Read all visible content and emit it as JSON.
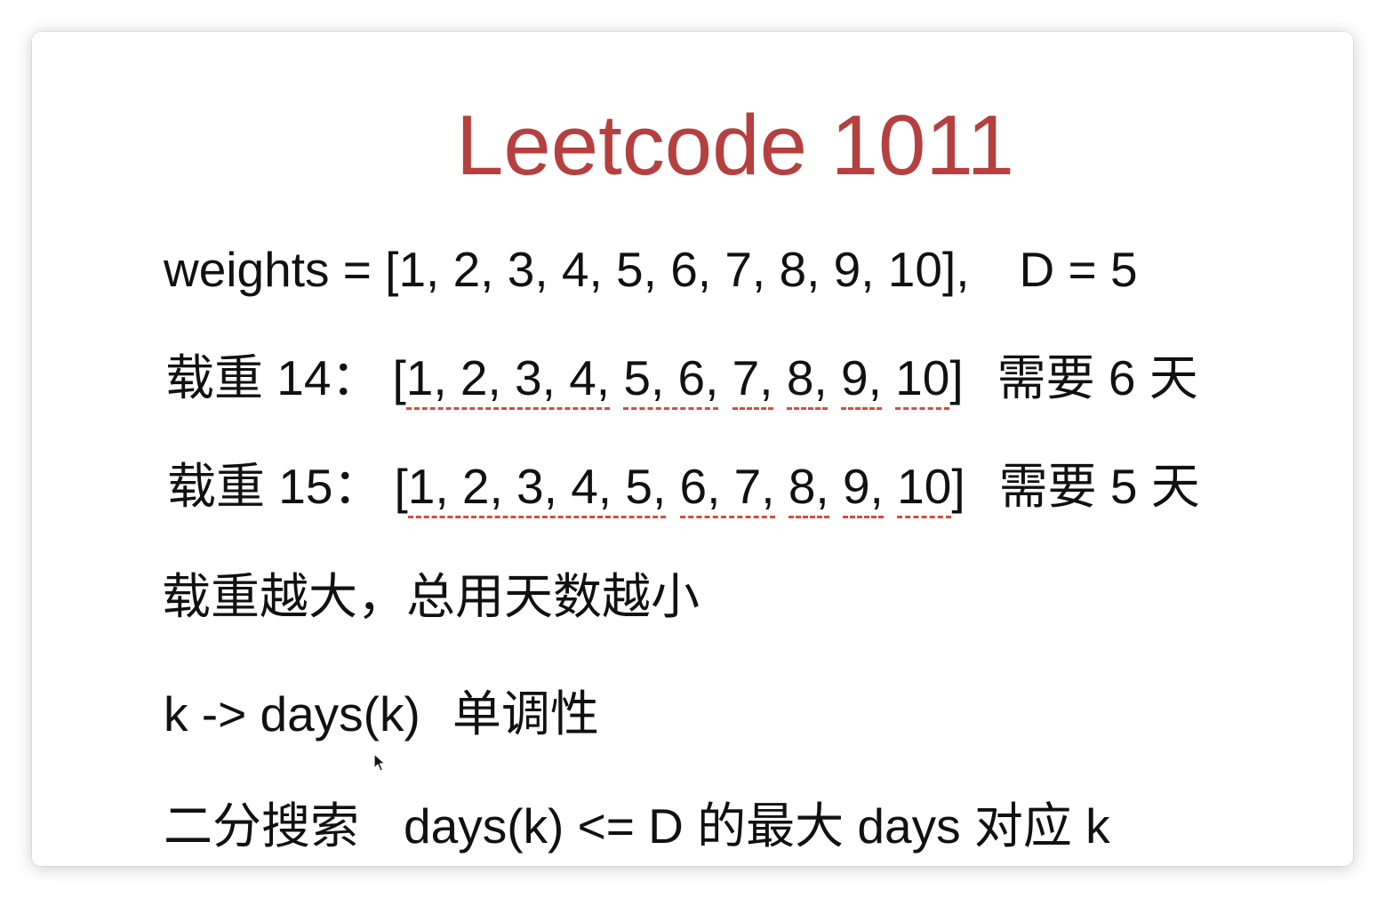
{
  "title": "Leetcode 1011",
  "line1": {
    "weights": "weights = [1, 2, 3, 4, 5, 6, 7, 8, 9, 10],",
    "d": "D = 5"
  },
  "line2": {
    "label": "载重 14：",
    "open": "[",
    "g1": "1, 2, 3, 4,",
    "g2": "5, 6,",
    "g3": "7,",
    "g4": "8,",
    "g5": "9,",
    "g6": "10",
    "close": "]",
    "result": "需要 6 天"
  },
  "line3": {
    "label": "载重 15：",
    "open": "[",
    "g1": "1, 2, 3, 4, 5,",
    "g2": "6, 7,",
    "g3": "8,",
    "g4": "9,",
    "g5": "10",
    "close": "]",
    "result": "需要 5 天"
  },
  "line4": "载重越大，总用天数越小",
  "line5": {
    "expr": "k -> days(k)",
    "note": "单调性"
  },
  "line6": {
    "label": "二分搜索",
    "expr": "days(k) <= D 的最大 days 对应 k"
  },
  "colors": {
    "title": "#b5403f",
    "underline": "#d64b3f",
    "text": "#111111"
  },
  "icons": {
    "cursor": "mouse-pointer-icon"
  }
}
